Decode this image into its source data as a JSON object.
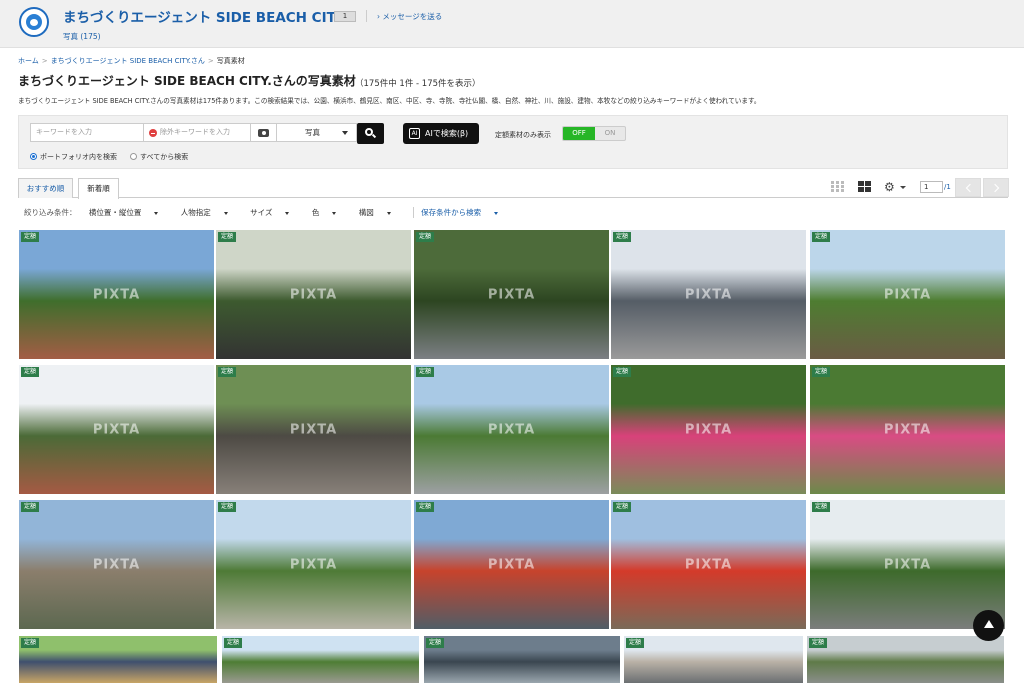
{
  "header": {
    "shop_name": "まちづくりエージェント SIDE BEACH CITY.",
    "badge": "1",
    "message_link": "› メッセージを送る",
    "photos_tab": "写真 (175)"
  },
  "breadcrumb": {
    "home": "ホーム",
    "shop": "まちづくりエージェント SIDE BEACH CITY.さん",
    "current": "写真素材",
    "separator": ">"
  },
  "page": {
    "title": "まちづくりエージェント SIDE BEACH CITY.さんの写真素材",
    "result_count": "（175件中 1件 - 175件を表示）",
    "description": "まちづくりエージェント SIDE BEACH CITY.さんの写真素材は175件あります。この検索結果では、公園、横浜市、鶴見区、南区、中区、寺、寺院、寺社仏閣、橋、自然、神社、川、施設、建物、本牧などの絞り込みキーワードがよく使われています。"
  },
  "search": {
    "keyword_placeholder": "キーワードを入力",
    "exclude_placeholder": "除外キーワードを入力",
    "type_selected": "写真",
    "ai_button": "AIで検索(β)",
    "ai_icon_text": "AI",
    "fixed_price_label": "定額素材のみ表示",
    "toggle_off": "OFF",
    "toggle_on": "ON",
    "radio_portfolio": "ポートフォリオ内を検索",
    "radio_all": "すべてから検索"
  },
  "tabs": [
    {
      "label": "おすすめ順"
    },
    {
      "label": "新着順"
    }
  ],
  "pagination": {
    "current": "1",
    "total": "/1"
  },
  "filters": {
    "label": "絞り込み条件：",
    "items": [
      "横位置・縦位置",
      "人物指定",
      "サイズ",
      "色",
      "構図"
    ],
    "saved": "保存条件から検索"
  },
  "photos": {
    "tag_label": "定額",
    "watermark": "PIXTA",
    "items": [
      {
        "name": "rose-garden-arch-path",
        "colors": [
          "#7aa7d6",
          "#3f6e2c",
          "#a35d45"
        ]
      },
      {
        "name": "stone-monument-plants",
        "colors": [
          "#cfd6c8",
          "#3d5a2f",
          "#333333"
        ]
      },
      {
        "name": "shaded-park-path",
        "colors": [
          "#4d6b3a",
          "#2d4521",
          "#7c7f84"
        ]
      },
      {
        "name": "modern-building-entrance",
        "colors": [
          "#dde3ea",
          "#555d66",
          "#9a9a9a"
        ]
      },
      {
        "name": "garden-gazebo",
        "colors": [
          "#bcd6ea",
          "#4e7d31",
          "#6a5b44"
        ]
      },
      {
        "name": "iron-arch-garden",
        "colors": [
          "#eef1f4",
          "#4b6a37",
          "#a55a44"
        ]
      },
      {
        "name": "stone-wall-greenery",
        "colors": [
          "#6e8f54",
          "#4d4a44",
          "#878079"
        ]
      },
      {
        "name": "park-bench-plaza",
        "colors": [
          "#a9c9e5",
          "#4b7a34",
          "#9da0a2"
        ]
      },
      {
        "name": "pink-bougainvillea-greenhouse",
        "colors": [
          "#3f6c2c",
          "#d8427a",
          "#7a8c5a"
        ]
      },
      {
        "name": "tropical-flowers",
        "colors": [
          "#4b7a33",
          "#d94c84",
          "#6c8a4a"
        ]
      },
      {
        "name": "temple-gate",
        "colors": [
          "#92b5d8",
          "#8b7e6c",
          "#5c6850"
        ]
      },
      {
        "name": "park-walkway-trees",
        "colors": [
          "#c2d9ec",
          "#4e7a36",
          "#b8b4a8"
        ]
      },
      {
        "name": "red-steel-bridge",
        "colors": [
          "#7fa9d4",
          "#c7432c",
          "#505d66"
        ]
      },
      {
        "name": "red-swing-playground",
        "colors": [
          "#9fbfe0",
          "#d43a2a",
          "#7a6a58"
        ]
      },
      {
        "name": "stone-monument-hedge",
        "colors": [
          "#e6ecef",
          "#3d6a2b",
          "#7b7d7c"
        ]
      },
      {
        "name": "temple-roof",
        "colors": [
          "#8fc06c",
          "#3f4f6e",
          "#c8a566"
        ]
      },
      {
        "name": "park-trees-sky",
        "colors": [
          "#cfe2f2",
          "#4e7d34",
          "#9a9a90"
        ]
      },
      {
        "name": "stone-plaque-wall",
        "colors": [
          "#6d7d8c",
          "#3a4650",
          "#9aa6ae"
        ]
      },
      {
        "name": "city-buildings",
        "colors": [
          "#dfe7ee",
          "#b9b1a6",
          "#6b6f72"
        ]
      },
      {
        "name": "stone-wall-ivy",
        "colors": [
          "#c6cdd0",
          "#5f7a48",
          "#8a8e8a"
        ]
      }
    ]
  }
}
